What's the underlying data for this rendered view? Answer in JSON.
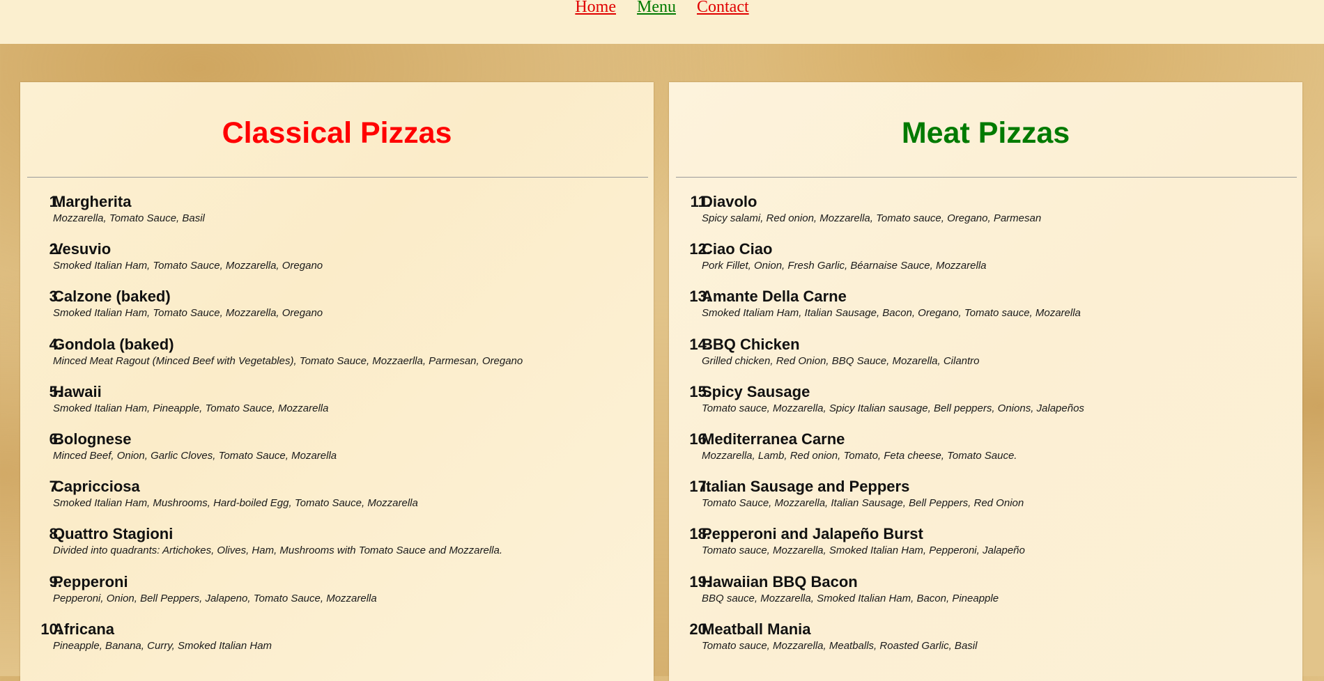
{
  "nav": {
    "links": [
      {
        "label": "Home",
        "color": "#e00000"
      },
      {
        "label": "Menu",
        "color": "#007a00"
      },
      {
        "label": "Contact",
        "color": "#e00000"
      }
    ]
  },
  "sections": [
    {
      "title": "Classical Pizzas",
      "title_color": "#ff0000",
      "items": [
        {
          "number": "1.",
          "name": "Margherita",
          "description": "Mozzarella, Tomato Sauce, Basil"
        },
        {
          "number": "2.",
          "name": "Vesuvio",
          "description": "Smoked Italian Ham, Tomato Sauce, Mozzarella, Oregano"
        },
        {
          "number": "3.",
          "name": "Calzone (baked)",
          "description": "Smoked Italian Ham, Tomato Sauce, Mozzarella, Oregano"
        },
        {
          "number": "4.",
          "name": "Gondola (baked)",
          "description": "Minced Meat Ragout (Minced Beef with Vegetables), Tomato Sauce, Mozzaerlla, Parmesan, Oregano"
        },
        {
          "number": "5.",
          "name": "Hawaii",
          "description": "Smoked Italian Ham, Pineapple, Tomato Sauce, Mozzarella"
        },
        {
          "number": "6.",
          "name": "Bolognese",
          "description": "Minced Beef, Onion, Garlic Cloves, Tomato Sauce, Mozarella"
        },
        {
          "number": "7.",
          "name": "Capricciosa",
          "description": "Smoked Italian Ham, Mushrooms, Hard-boiled Egg, Tomato Sauce, Mozzarella"
        },
        {
          "number": "8.",
          "name": "Quattro Stagioni",
          "description": "Divided into quadrants: Artichokes, Olives, Ham, Mushrooms with Tomato Sauce and Mozzarella."
        },
        {
          "number": "9.",
          "name": "Pepperoni",
          "description": "Pepperoni, Onion, Bell Peppers, Jalapeno, Tomato Sauce, Mozzarella"
        },
        {
          "number": "10.",
          "name": "Africana",
          "description": "Pineapple, Banana, Curry, Smoked Italian Ham"
        }
      ]
    },
    {
      "title": "Meat Pizzas",
      "title_color": "#007a00",
      "items": [
        {
          "number": "11.",
          "name": "Diavolo",
          "description": "Spicy salami, Red onion, Mozzarella, Tomato sauce, Oregano, Parmesan"
        },
        {
          "number": "12.",
          "name": "Ciao Ciao",
          "description": "Pork Fillet, Onion, Fresh Garlic, Béarnaise Sauce, Mozzarella"
        },
        {
          "number": "13.",
          "name": "Amante Della Carne",
          "description": "Smoked Italiam Ham, Italian Sausage, Bacon, Oregano, Tomato sauce, Mozarella"
        },
        {
          "number": "14.",
          "name": "BBQ Chicken",
          "description": "Grilled chicken, Red Onion, BBQ Sauce, Mozarella, Cilantro"
        },
        {
          "number": "15.",
          "name": "Spicy Sausage",
          "description": "Tomato sauce, Mozzarella, Spicy Italian sausage, Bell peppers, Onions, Jalapeños"
        },
        {
          "number": "16.",
          "name": "Mediterranea Carne",
          "description": "Mozzarella, Lamb, Red onion, Tomato, Feta cheese, Tomato Sauce."
        },
        {
          "number": "17.",
          "name": "Italian Sausage and Peppers",
          "description": "Tomato Sauce, Mozzarella, Italian Sausage, Bell Peppers, Red Onion"
        },
        {
          "number": "18.",
          "name": "Pepperoni and Jalapeño Burst",
          "description": "Tomato sauce, Mozzarella, Smoked Italian Ham, Pepperoni, Jalapeño"
        },
        {
          "number": "19.",
          "name": "Hawaiian BBQ Bacon",
          "description": "BBQ sauce, Mozzarella, Smoked Italian Ham, Bacon, Pineapple"
        },
        {
          "number": "20.",
          "name": "Meatball Mania",
          "description": "Tomato sauce, Mozzarella, Meatballs, Roasted Garlic, Basil"
        }
      ]
    }
  ]
}
